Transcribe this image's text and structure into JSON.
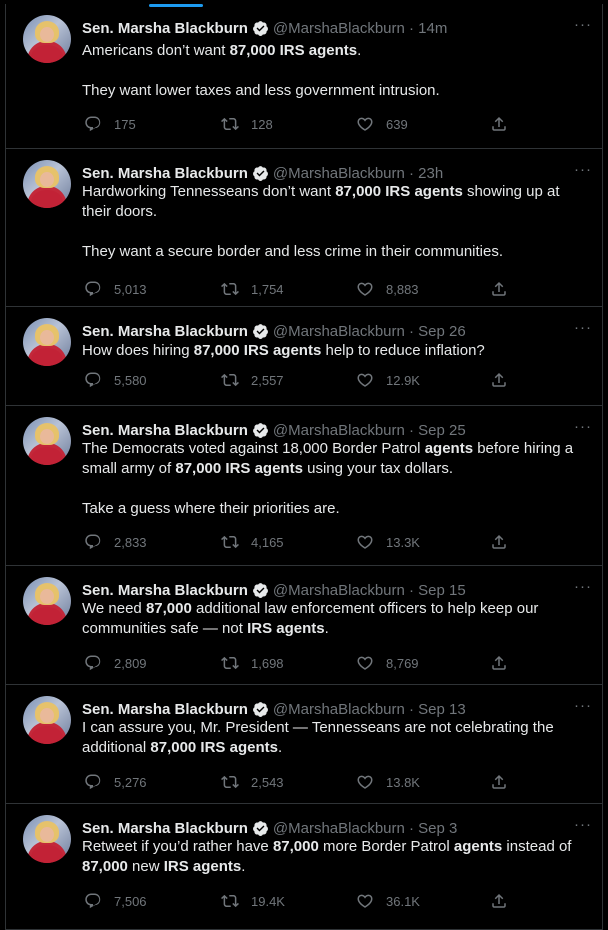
{
  "author": {
    "name": "Sen. Marsha Blackburn",
    "handle": "@MarshaBlackburn"
  },
  "tweets": [
    {
      "time": "14m",
      "paragraphs": [
        [
          {
            "t": "Americans don’t want "
          },
          {
            "t": "87,000 IRS agents",
            "b": true
          },
          {
            "t": "."
          }
        ],
        [
          {
            "t": "They want lower taxes and less government intrusion."
          }
        ]
      ],
      "replies": "175",
      "retweets": "128",
      "likes": "639"
    },
    {
      "time": "23h",
      "paragraphs": [
        [
          {
            "t": "Hardworking Tennesseans don’t want "
          },
          {
            "t": "87,000 IRS agents",
            "b": true
          },
          {
            "t": " showing up at their doors."
          }
        ],
        [
          {
            "t": "They want a secure border and less crime in their communities."
          }
        ]
      ],
      "replies": "5,013",
      "retweets": "1,754",
      "likes": "8,883"
    },
    {
      "time": "Sep 26",
      "paragraphs": [
        [
          {
            "t": "How does hiring "
          },
          {
            "t": "87,000 IRS agents",
            "b": true
          },
          {
            "t": " help to reduce inflation?"
          }
        ]
      ],
      "replies": "5,580",
      "retweets": "2,557",
      "likes": "12.9K"
    },
    {
      "time": "Sep 25",
      "paragraphs": [
        [
          {
            "t": "The Democrats voted against 18,000 Border Patrol "
          },
          {
            "t": "agents",
            "b": true
          },
          {
            "t": " before hiring a small army of "
          },
          {
            "t": "87,000 IRS agents",
            "b": true
          },
          {
            "t": " using your tax dollars."
          }
        ],
        [
          {
            "t": "Take a guess where their priorities are."
          }
        ]
      ],
      "replies": "2,833",
      "retweets": "4,165",
      "likes": "13.3K"
    },
    {
      "time": "Sep 15",
      "paragraphs": [
        [
          {
            "t": "We need "
          },
          {
            "t": "87,000",
            "b": true
          },
          {
            "t": " additional law enforcement officers to help keep our communities safe — not "
          },
          {
            "t": "IRS agents",
            "b": true
          },
          {
            "t": "."
          }
        ]
      ],
      "replies": "2,809",
      "retweets": "1,698",
      "likes": "8,769"
    },
    {
      "time": "Sep 13",
      "paragraphs": [
        [
          {
            "t": "I can assure you, Mr. President — Tennesseans are not celebrating the additional "
          },
          {
            "t": "87,000 IRS agents",
            "b": true
          },
          {
            "t": "."
          }
        ]
      ],
      "replies": "5,276",
      "retweets": "2,543",
      "likes": "13.8K"
    },
    {
      "time": "Sep 3",
      "paragraphs": [
        [
          {
            "t": "Retweet if you’d rather have "
          },
          {
            "t": "87,000",
            "b": true
          },
          {
            "t": " more Border Patrol "
          },
          {
            "t": "agents",
            "b": true
          },
          {
            "t": " instead of "
          },
          {
            "t": "87,000",
            "b": true
          },
          {
            "t": " new "
          },
          {
            "t": "IRS agents",
            "b": true
          },
          {
            "t": "."
          }
        ]
      ],
      "replies": "7,506",
      "retweets": "19.4K",
      "likes": "36.1K"
    }
  ],
  "icons": [
    "verified-badge-icon",
    "more-icon",
    "reply-icon",
    "retweet-icon",
    "like-icon",
    "share-icon"
  ],
  "colors": {
    "background": "#000000",
    "text": "#e7e9ea",
    "muted": "#71767b",
    "divider": "#2f3336",
    "accent": "#1d9bf0"
  }
}
